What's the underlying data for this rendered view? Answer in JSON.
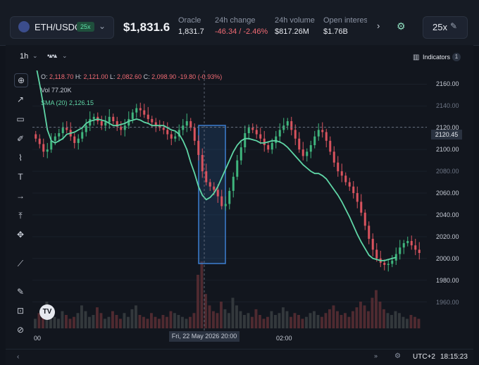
{
  "header": {
    "pair": "ETH/USDC",
    "leverage_badge": "25x",
    "price": "$1,831.6",
    "oracle_label": "Oracle",
    "oracle_value": "1,831.7",
    "change_label": "24h change",
    "change_value": "-46.34 / -2.46%",
    "volume_label": "24h volume",
    "volume_value": "$817.26M",
    "oi_label": "Open interes",
    "oi_value": "$1.76B",
    "leverage_button": "25x"
  },
  "chart_toolbar": {
    "timeframe": "1h",
    "indicators_label": "Indicators",
    "indicators_count": "1"
  },
  "legend": {
    "o_label": "O:",
    "o": "2,118.70",
    "h_label": "H:",
    "h": "2,121.00",
    "l_label": "L:",
    "l": "2,082.60",
    "c_label": "C:",
    "c": "2,098.90",
    "change": "-19.80 (-0.93%)",
    "vol_label": "Vol",
    "vol": "77.20K",
    "sma_label": "SMA (20)",
    "sma": "2,126.15"
  },
  "current_price_label": "2120.45",
  "hover_time_label": "Fri, 22 May 2026 20:00",
  "footer": {
    "timezone": "UTC+2",
    "clock": "18:15:23"
  },
  "chart_data": {
    "type": "candlestick",
    "y_ticks": [
      "2160.00",
      "2140.00",
      "2120.00",
      "2100.00",
      "2080.00",
      "2060.00",
      "2040.00",
      "2020.00",
      "2000.00",
      "1980.00",
      "1960.00"
    ],
    "x_ticks": [
      "00",
      "02:00"
    ],
    "ylim": [
      1950,
      2170
    ],
    "close": [
      2110,
      2105,
      2098,
      2100,
      2108,
      2112,
      2115,
      2120,
      2118,
      2112,
      2106,
      2110,
      2116,
      2122,
      2128,
      2130,
      2126,
      2122,
      2125,
      2130,
      2126,
      2121,
      2118,
      2122,
      2128,
      2134,
      2138,
      2136,
      2132,
      2128,
      2125,
      2122,
      2120,
      2118,
      2114,
      2110,
      2112,
      2118,
      2122,
      2126,
      2120,
      2108,
      2095,
      2080,
      2070,
      2066,
      2063,
      2057,
      2048,
      2050,
      2062,
      2075,
      2090,
      2102,
      2115,
      2120,
      2118,
      2114,
      2110,
      2104,
      2100,
      2106,
      2112,
      2118,
      2122,
      2126,
      2118,
      2110,
      2100,
      2094,
      2098,
      2104,
      2112,
      2118,
      2116,
      2108,
      2098,
      2088,
      2080,
      2076,
      2070,
      2066,
      2060,
      2052,
      2042,
      2030,
      2018,
      2008,
      2000,
      1996,
      1994,
      1995,
      1998,
      2004,
      2010,
      2014,
      2016,
      2012,
      2008,
      2005
    ],
    "sma_20": [
      2178,
      2160,
      2140,
      2118,
      2108,
      2106,
      2108,
      2110,
      2114,
      2115,
      2116,
      2118,
      2120,
      2124,
      2126,
      2127,
      2128,
      2127,
      2126,
      2124,
      2122,
      2122,
      2123,
      2124,
      2126,
      2127,
      2128,
      2127,
      2125,
      2124,
      2122,
      2122,
      2122,
      2122,
      2120,
      2118,
      2117,
      2114,
      2108,
      2100,
      2088,
      2078,
      2066,
      2058,
      2054,
      2056,
      2060,
      2066,
      2074,
      2082,
      2090,
      2098,
      2104,
      2108,
      2110,
      2110,
      2109,
      2108,
      2106,
      2106,
      2107,
      2108,
      2108,
      2107,
      2105,
      2102,
      2098,
      2094,
      2090,
      2086,
      2083,
      2080,
      2078,
      2078,
      2076,
      2073,
      2068,
      2063,
      2058,
      2052,
      2045,
      2038,
      2030,
      2022,
      2015,
      2009,
      2003,
      2000,
      1999,
      1998,
      1998,
      1999,
      2000,
      2001
    ],
    "volume": [
      5,
      8,
      6,
      14,
      10,
      6,
      5,
      9,
      7,
      5,
      6,
      8,
      12,
      9,
      6,
      7,
      11,
      8,
      5,
      6,
      9,
      7,
      5,
      8,
      6,
      10,
      12,
      7,
      6,
      5,
      8,
      6,
      5,
      7,
      6,
      9,
      8,
      7,
      6,
      5,
      6,
      8,
      28,
      35,
      18,
      12,
      9,
      8,
      14,
      10,
      8,
      16,
      12,
      9,
      7,
      8,
      6,
      10,
      7,
      5,
      6,
      9,
      7,
      8,
      11,
      9,
      6,
      8,
      7,
      5,
      6,
      8,
      9,
      7,
      6,
      8,
      10,
      12,
      9,
      7,
      8,
      6,
      9,
      11,
      14,
      12,
      9,
      16,
      20,
      14,
      10,
      8,
      7,
      9,
      8,
      6,
      5,
      7,
      6,
      5
    ]
  }
}
